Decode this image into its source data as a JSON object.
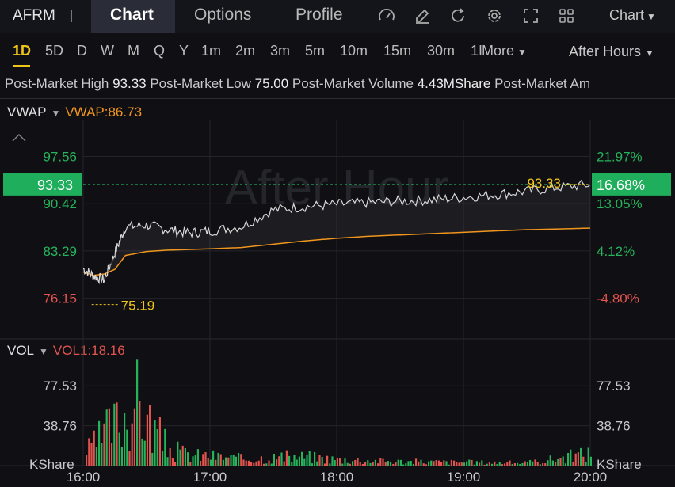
{
  "header": {
    "symbol": "AFRM",
    "tabs": [
      {
        "label": "Chart",
        "active": true
      },
      {
        "label": "Options",
        "active": false
      },
      {
        "label": "Profile",
        "active": false
      }
    ],
    "icons": [
      "gauge-icon",
      "edit-icon",
      "refresh-icon",
      "settings-icon",
      "fullscreen-icon",
      "grid-icon"
    ],
    "chart_menu_label": "Chart"
  },
  "periods": {
    "items": [
      "1D",
      "5D",
      "D",
      "W",
      "M",
      "Q",
      "Y",
      "1m",
      "2m",
      "3m",
      "5m",
      "10m",
      "15m",
      "30m",
      "1I"
    ],
    "active": "1D",
    "more_label": "More",
    "session_label": "After Hours"
  },
  "stats": {
    "high_label": "Post-Market High",
    "high_value": "93.33",
    "low_label": "Post-Market Low",
    "low_value": "75.00",
    "volume_label": "Post-Market Volume",
    "volume_value": "4.43MShare",
    "amount_label": "Post-Market Am"
  },
  "price_panel": {
    "indicator": "VWAP",
    "indicator_value": "VWAP:86.73",
    "watermark": "After Hour",
    "current_price": "93.33",
    "current_pct": "16.68%",
    "high_marker": "93.33",
    "low_marker": "75.19"
  },
  "volume_panel": {
    "indicator": "VOL",
    "indicator_value": "VOL1:18.16",
    "unit": "KShare"
  },
  "colors": {
    "up": "#26b35a",
    "down": "#e4544f",
    "price_line": "#d8d8d8",
    "vwap_line": "#f0961e",
    "marker": "#f0c419",
    "badge": "#1fae5c"
  },
  "chart_data": [
    {
      "type": "line",
      "title": "",
      "series": [
        {
          "name": "",
          "x": [
            "16:00",
            "16:05",
            "16:10",
            "16:15",
            "16:20",
            "16:30",
            "16:40",
            "16:50",
            "17:00",
            "17:15",
            "17:30",
            "17:45",
            "18:00",
            "18:15",
            "18:30",
            "18:45",
            "19:00",
            "19:15",
            "19:30",
            "19:45",
            "20:00"
          ],
          "values": [
            80.6,
            79.5,
            78.9,
            83.0,
            86.9,
            87.2,
            86.5,
            86.0,
            86.3,
            87.0,
            89.5,
            90.0,
            90.3,
            90.6,
            90.8,
            91.0,
            91.4,
            91.8,
            92.3,
            92.9,
            93.3
          ]
        },
        {
          "name": "VWAP",
          "values": [
            80.1,
            79.6,
            79.8,
            80.5,
            82.6,
            83.2,
            83.4,
            83.5,
            83.6,
            83.8,
            84.3,
            84.8,
            85.2,
            85.5,
            85.7,
            85.9,
            86.1,
            86.3,
            86.5,
            86.6,
            86.73
          ]
        }
      ],
      "x_ticks": [
        "16:00",
        "17:00",
        "18:00",
        "19:00",
        "20:00"
      ],
      "y_ticks": [
        97.56,
        90.42,
        83.29,
        76.15
      ],
      "y_ticks_pct": [
        "21.97%",
        "13.05%",
        "4.12%",
        "-4.80%"
      ],
      "ylim": [
        70.0,
        103.0
      ],
      "grid": true
    },
    {
      "type": "bar",
      "title": "",
      "y_ticks": [
        77.53,
        38.76
      ],
      "ylabel": "KShare",
      "ylim": [
        0,
        110
      ],
      "series": [
        {
          "name": "",
          "x": [
            "16:00",
            "16:05",
            "16:10",
            "16:15",
            "16:20",
            "16:25",
            "16:30",
            "16:40",
            "16:50",
            "17:00",
            "17:15",
            "17:30",
            "17:45",
            "18:00",
            "18:30",
            "19:00",
            "19:30",
            "20:00"
          ],
          "values": [
            18,
            30,
            48,
            60,
            78,
            92,
            66,
            24,
            15,
            14,
            10,
            12,
            13,
            9,
            6,
            5,
            4,
            18
          ]
        }
      ]
    }
  ]
}
